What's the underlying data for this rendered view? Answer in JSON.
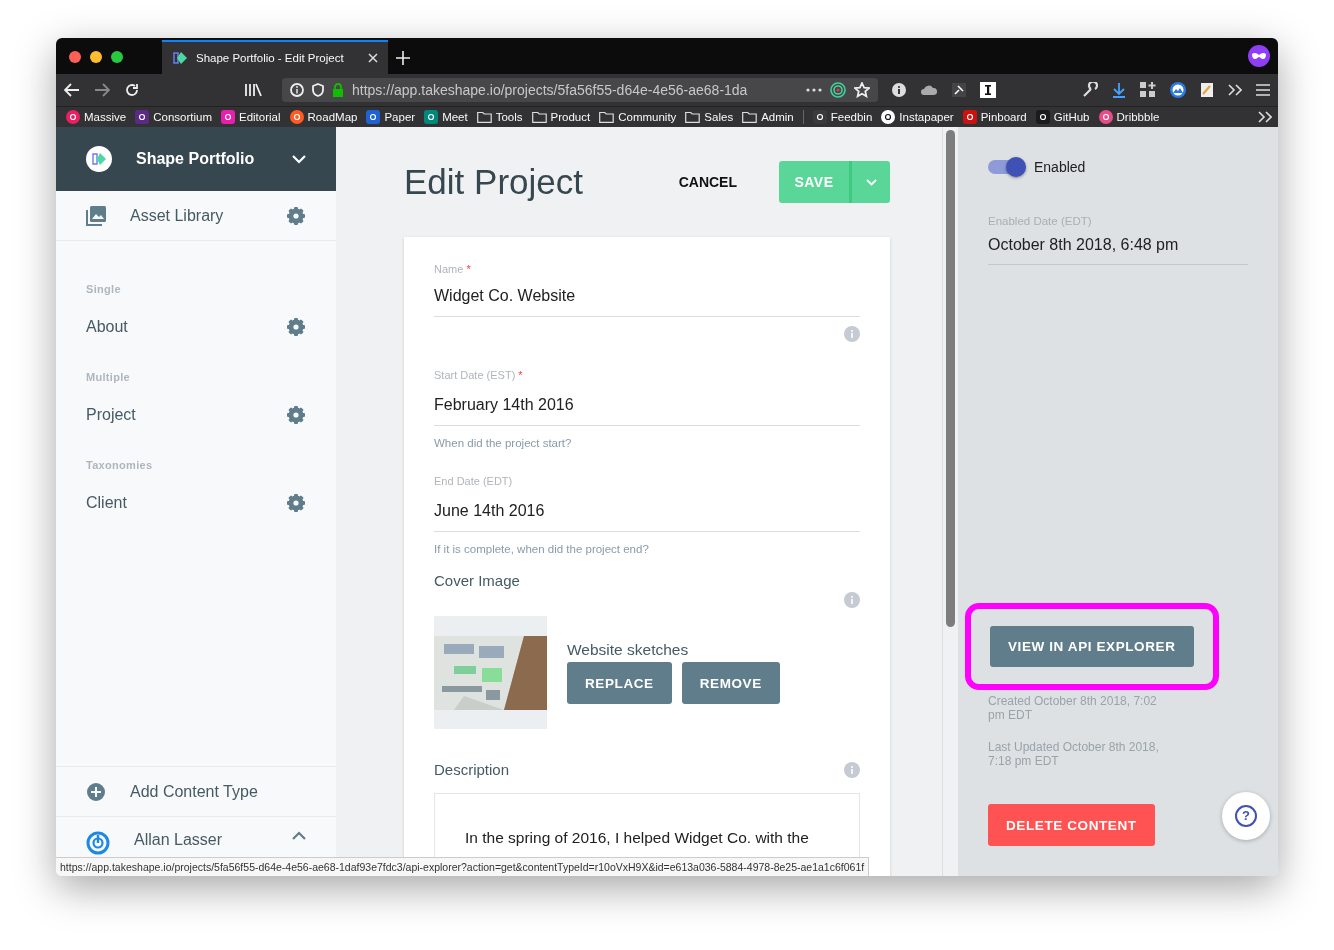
{
  "browser": {
    "tabs": [
      {
        "title": "Shape Portfolio - Edit Project",
        "selected": true
      }
    ],
    "url": "https://app.takeshape.io/projects/5fa56f55-d64e-4e56-ae68-1da",
    "bookmarks": [
      {
        "label": "Massive",
        "kind": "site",
        "color": "#e91e63"
      },
      {
        "label": "Consortium",
        "kind": "site",
        "color": "#5b2a86"
      },
      {
        "label": "Editorial",
        "kind": "site",
        "color": "#e91eac"
      },
      {
        "label": "RoadMap",
        "kind": "site",
        "color": "#ff5b22"
      },
      {
        "label": "Paper",
        "kind": "site",
        "color": "#1e63d6"
      },
      {
        "label": "Meet",
        "kind": "site",
        "color": "#00897b"
      },
      {
        "label": "Tools",
        "kind": "folder"
      },
      {
        "label": "Product",
        "kind": "folder"
      },
      {
        "label": "Community",
        "kind": "folder"
      },
      {
        "label": "Sales",
        "kind": "folder"
      },
      {
        "label": "Admin",
        "kind": "folder"
      },
      {
        "label": "Feedbin",
        "kind": "site",
        "color": "#3a3a3a"
      },
      {
        "label": "Instapaper",
        "kind": "site",
        "color": "#ffffff"
      },
      {
        "label": "Pinboard",
        "kind": "site",
        "color": "#cc1111"
      },
      {
        "label": "GitHub",
        "kind": "site",
        "color": "#1b1b1b"
      },
      {
        "label": "Dribbble",
        "kind": "site",
        "color": "#ea4c89"
      }
    ]
  },
  "sidebar": {
    "project": "Shape Portfolio",
    "asset_library": "Asset Library",
    "sections": [
      {
        "heading": "Single",
        "items": [
          "About"
        ]
      },
      {
        "heading": "Multiple",
        "items": [
          "Project"
        ]
      },
      {
        "heading": "Taxonomies",
        "items": [
          "Client"
        ]
      }
    ],
    "add_content_type": "Add Content Type",
    "user": "Allan Lasser"
  },
  "editor": {
    "title": "Edit Project",
    "cancel": "CANCEL",
    "save": "SAVE",
    "fields": [
      {
        "kind": "text",
        "label": "Name",
        "required_mark": "*",
        "info": true,
        "value": "Widget Co. Website"
      },
      {
        "kind": "text",
        "label": "Start Date (EST)",
        "required_mark": "*",
        "info": false,
        "value": "February 14th 2016",
        "help": "When did the project start?"
      },
      {
        "kind": "text",
        "label": "End Date (EDT)",
        "info": false,
        "value": "June 14th 2016",
        "help": "If it is complete, when did the project end?"
      },
      {
        "label": "Cover Image",
        "info": true,
        "caption": "Website sketches",
        "buttons": [
          "REPLACE",
          "REMOVE"
        ]
      },
      {
        "kind": "textarea",
        "label": "Description",
        "info": true,
        "value": "In the spring of 2016, I helped Widget Co. with the"
      }
    ]
  },
  "meta": {
    "toggle": {
      "label": "Enabled",
      "on": true
    },
    "enabled_date": {
      "label": "Enabled Date (EDT)",
      "value": "October 8th 2018, 6:48 pm"
    },
    "api_button": "VIEW IN API EXPLORER",
    "created": "Created October 8th 2018, 7:02 pm EDT",
    "updated": "Last Updated October 8th 2018, 7:18 pm EDT",
    "delete_button": "DELETE CONTENT",
    "help_button": "?"
  },
  "status_bar": "https://app.takeshape.io/projects/5fa56f55-d64e-4e56-ae68-1daf93e7fdc3/api-explorer?action=get&contentTypeId=r10oVxH9X&id=e613a036-5884-4978-8e25-ae1a1c6f061f"
}
